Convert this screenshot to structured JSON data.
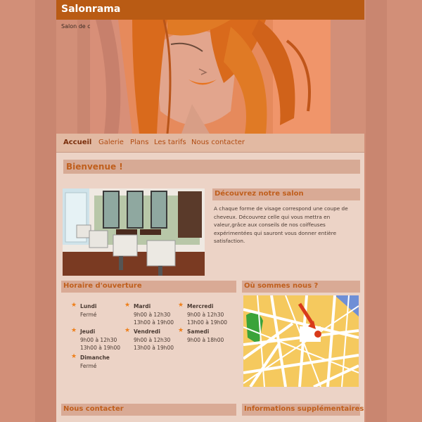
{
  "site": {
    "brand": "Salonrama",
    "subtitle": "Salon de coiffure"
  },
  "nav": {
    "items": [
      "Accueil",
      "Galerie",
      "Plans",
      "Les tarifs",
      "Nous contacter"
    ]
  },
  "welcome_title": "Bienvenue !",
  "discover": {
    "title": "Découvrez notre salon",
    "text": "A chaque forme de visage correspond une coupe de cheveux. Découvrez celle qui vous mettra en valeur,grâce aux conseils de nos coiffeuses expérimentées qui sauront vous donner entière satisfaction."
  },
  "hours": {
    "title": "Horaire d'ouverture",
    "days": [
      {
        "name": "Lundi",
        "lines": [
          "Fermé"
        ]
      },
      {
        "name": "Mardi",
        "lines": [
          "9h00 à 12h30",
          "13h00 à 19h00"
        ]
      },
      {
        "name": "Mercredi",
        "lines": [
          "9h00 à 12h30",
          "13h00 à 19h00"
        ]
      },
      {
        "name": "Jeudi",
        "lines": [
          "9h00 à 12h30",
          "13h00 à 19h00"
        ]
      },
      {
        "name": "Vendredi",
        "lines": [
          "9h00 à 12h30",
          "13h00 à 19h00"
        ]
      },
      {
        "name": "Samedi",
        "lines": [
          "9h00 à 18h00"
        ]
      },
      {
        "name": "Dimanche",
        "lines": [
          "Fermé"
        ]
      }
    ]
  },
  "location": {
    "title": "Où sommes nous ?"
  },
  "contact": {
    "title": "Nous contacter"
  },
  "info": {
    "title": "Informations supplémentaires"
  },
  "colors": {
    "accent": "#b95b14",
    "heading": "#c05f1d",
    "star": "#ee7f1a"
  }
}
